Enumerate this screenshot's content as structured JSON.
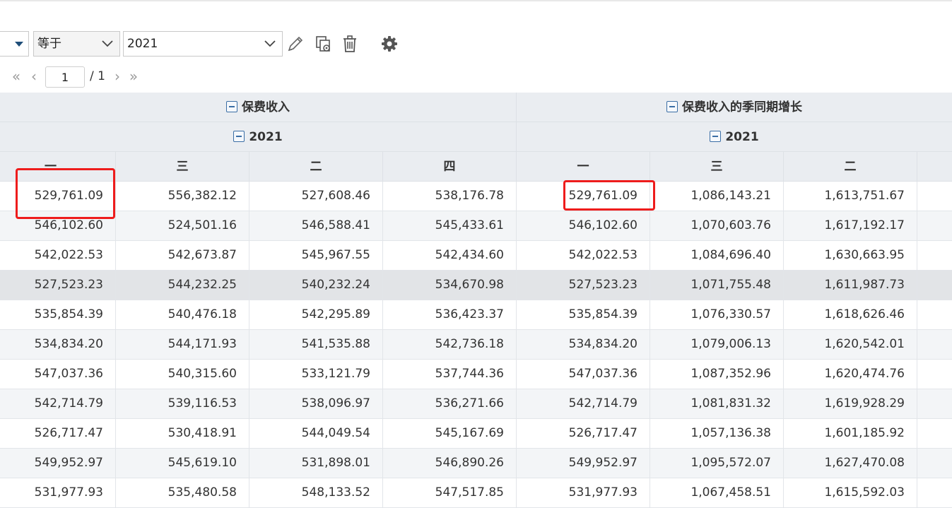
{
  "filter": {
    "operator": "等于",
    "value": "2021"
  },
  "toolbar_icons": [
    "pencil-icon",
    "copy-settings-icon",
    "trash-icon",
    "gear-icon"
  ],
  "pager": {
    "current_page": "1",
    "total": "/ 1"
  },
  "header": {
    "groups": [
      "保费收入",
      "保费收入的季同期增长"
    ],
    "year": "2021",
    "quarters": [
      "一",
      "三",
      "二",
      "四",
      "一",
      "三",
      "二"
    ]
  },
  "rows": [
    [
      "529,761.09",
      "556,382.12",
      "527,608.46",
      "538,176.78",
      "529,761.09",
      "1,086,143.21",
      "1,613,751.67"
    ],
    [
      "546,102.60",
      "524,501.16",
      "546,588.41",
      "545,433.61",
      "546,102.60",
      "1,070,603.76",
      "1,617,192.17"
    ],
    [
      "542,022.53",
      "542,673.87",
      "545,967.55",
      "542,434.60",
      "542,022.53",
      "1,084,696.40",
      "1,630,663.95"
    ],
    [
      "527,523.23",
      "544,232.25",
      "540,232.24",
      "534,670.98",
      "527,523.23",
      "1,071,755.48",
      "1,611,987.73"
    ],
    [
      "535,854.39",
      "540,476.18",
      "542,295.89",
      "536,423.37",
      "535,854.39",
      "1,076,330.57",
      "1,618,626.46"
    ],
    [
      "534,834.20",
      "544,171.93",
      "541,535.88",
      "542,736.18",
      "534,834.20",
      "1,079,006.13",
      "1,620,542.01"
    ],
    [
      "547,037.36",
      "540,315.60",
      "533,121.79",
      "537,744.36",
      "547,037.36",
      "1,087,352.96",
      "1,620,474.76"
    ],
    [
      "542,714.79",
      "539,116.53",
      "538,096.97",
      "536,271.66",
      "542,714.79",
      "1,081,831.32",
      "1,619,928.29"
    ],
    [
      "526,717.47",
      "530,418.91",
      "544,049.54",
      "545,167.69",
      "526,717.47",
      "1,057,136.38",
      "1,601,185.92"
    ],
    [
      "549,952.97",
      "545,619.10",
      "531,898.01",
      "546,890.26",
      "549,952.97",
      "1,095,572.07",
      "1,627,470.08"
    ],
    [
      "531,977.93",
      "535,480.58",
      "548,133.52",
      "547,517.85",
      "531,977.93",
      "1,067,458.51",
      "1,615,592.03"
    ]
  ],
  "colors": {
    "highlight_box": "#ee1c1c",
    "header_bg": "#eaedf1",
    "icon_blue": "#3b6ea5"
  }
}
